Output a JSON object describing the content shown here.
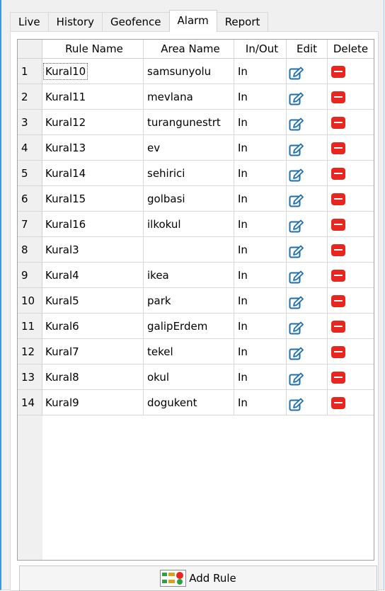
{
  "tabs": [
    "Live",
    "History",
    "Geofence",
    "Alarm",
    "Report"
  ],
  "active_tab": "Alarm",
  "table": {
    "headers": {
      "rule": "Rule Name",
      "area": "Area Name",
      "inout": "In/Out",
      "edit": "Edit",
      "delete": "Delete"
    },
    "rows": [
      {
        "idx": "1",
        "rule": "Kural10",
        "area": "samsunyolu",
        "inout": "In"
      },
      {
        "idx": "2",
        "rule": "Kural11",
        "area": "mevlana",
        "inout": "In"
      },
      {
        "idx": "3",
        "rule": "Kural12",
        "area": "turangunestrt",
        "inout": "In"
      },
      {
        "idx": "4",
        "rule": "Kural13",
        "area": "ev",
        "inout": "In"
      },
      {
        "idx": "5",
        "rule": "Kural14",
        "area": "sehirici",
        "inout": "In"
      },
      {
        "idx": "6",
        "rule": "Kural15",
        "area": "golbasi",
        "inout": "In"
      },
      {
        "idx": "7",
        "rule": "Kural16",
        "area": "ilkokul",
        "inout": "In"
      },
      {
        "idx": "8",
        "rule": "Kural3",
        "area": "",
        "inout": "In"
      },
      {
        "idx": "9",
        "rule": "Kural4",
        "area": "ikea",
        "inout": "In"
      },
      {
        "idx": "10",
        "rule": "Kural5",
        "area": "park",
        "inout": "In"
      },
      {
        "idx": "11",
        "rule": "Kural6",
        "area": "galipErdem",
        "inout": "In"
      },
      {
        "idx": "12",
        "rule": "Kural7",
        "area": "tekel",
        "inout": "In"
      },
      {
        "idx": "13",
        "rule": "Kural8",
        "area": "okul",
        "inout": "In"
      },
      {
        "idx": "14",
        "rule": "Kural9",
        "area": "dogukent",
        "inout": "In"
      }
    ]
  },
  "add_button": {
    "label": "Add Rule"
  },
  "icons": {
    "edit": "edit-pencil-icon",
    "delete": "delete-minus-icon",
    "add": "add-rule-icon"
  },
  "colors": {
    "accent_border": "#3c9ad8",
    "edit_icon": "#1e6fa8",
    "delete_icon": "#e8261f"
  }
}
